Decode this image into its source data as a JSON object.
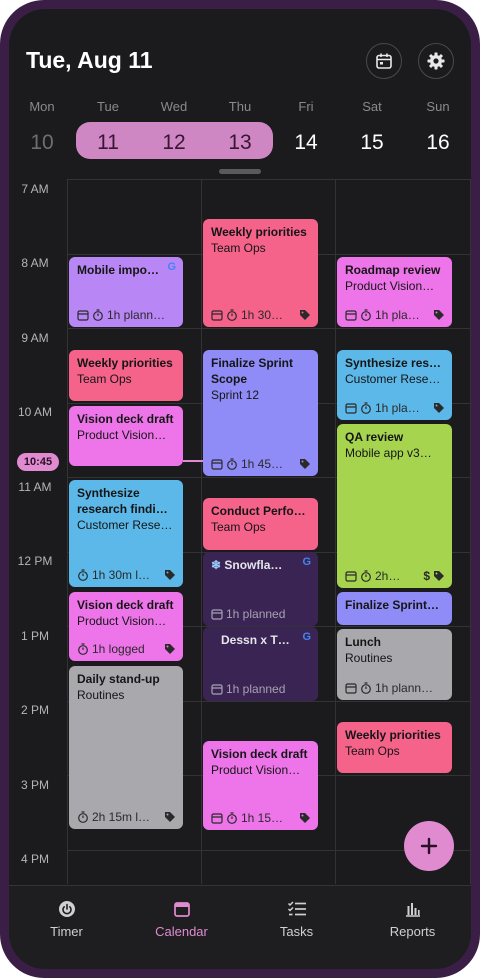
{
  "header": {
    "title": "Tue, Aug 11"
  },
  "days": [
    {
      "name": "Mon",
      "num": "10"
    },
    {
      "name": "Tue",
      "num": "11"
    },
    {
      "name": "Wed",
      "num": "12"
    },
    {
      "name": "Thu",
      "num": "13"
    },
    {
      "name": "Fri",
      "num": "14"
    },
    {
      "name": "Sat",
      "num": "15"
    },
    {
      "name": "Sun",
      "num": "16"
    }
  ],
  "hours": [
    "7 AM",
    "8 AM",
    "9 AM",
    "10 AM",
    "11 AM",
    "12 PM",
    "1 PM",
    "2 PM",
    "3 PM",
    "4 PM"
  ],
  "now": {
    "label": "10:45"
  },
  "events": {
    "mobile_import": {
      "title": "Mobile impo…",
      "foot": "1h plann…"
    },
    "weekly_wed": {
      "title": "Weekly priorities",
      "sub": "Team Ops",
      "foot": "1h 30…"
    },
    "roadmap": {
      "title": "Roadmap review",
      "sub": "Product Vision…",
      "foot": "1h pla…"
    },
    "weekly_tue": {
      "title": "Weekly priorities",
      "sub": "Team Ops"
    },
    "finalize_wed": {
      "title": "Finalize Sprint",
      "title2": "Scope",
      "sub": "Sprint 12",
      "foot": "1h 45…"
    },
    "synth_thu": {
      "title": "Synthesize res…",
      "sub": "Customer Rese…",
      "foot": "1h pla…"
    },
    "vision_tue1": {
      "title": "Vision deck draft",
      "sub": "Product Vision…"
    },
    "qa": {
      "title": "QA review",
      "sub": "Mobile app v3…",
      "foot": "2h…"
    },
    "synth_tue": {
      "title": "Synthesize",
      "title2": "research findin…",
      "sub": "Customer Rese…",
      "foot": "1h 30m l…"
    },
    "conduct": {
      "title": "Conduct Perfo…",
      "sub": "Team Ops"
    },
    "snowflake": {
      "title": "Snowfla…",
      "foot": "1h planned"
    },
    "finalize_thu": {
      "title": "Finalize Sprint…"
    },
    "vision_tue2": {
      "title": "Vision deck draft",
      "sub": "Product Vision…",
      "foot": "1h logged"
    },
    "dessn": {
      "title": "Dessn x T…",
      "foot": "1h planned"
    },
    "lunch": {
      "title": "Lunch",
      "sub": "Routines",
      "foot": "1h plann…"
    },
    "standup": {
      "title": "Daily stand-up",
      "sub": "Routines",
      "foot": "2h 15m l…"
    },
    "weekly_thu": {
      "title": "Weekly priorities",
      "sub": "Team Ops"
    },
    "vision_wed": {
      "title": "Vision deck draft",
      "sub": "Product Vision…",
      "foot": "1h 15…"
    }
  },
  "nav": [
    {
      "label": "Timer"
    },
    {
      "label": "Calendar"
    },
    {
      "label": "Tasks"
    },
    {
      "label": "Reports"
    }
  ],
  "colors": {
    "accent": "#e08ad0",
    "purple": "#b887f5",
    "red": "#f5628a",
    "magenta": "#ee74ea",
    "blue": "#5cb8e8",
    "periwinkle": "#8f8cf7",
    "green": "#a6d44e",
    "gray": "#a9a8ad",
    "dark_event": "#3a2454"
  }
}
